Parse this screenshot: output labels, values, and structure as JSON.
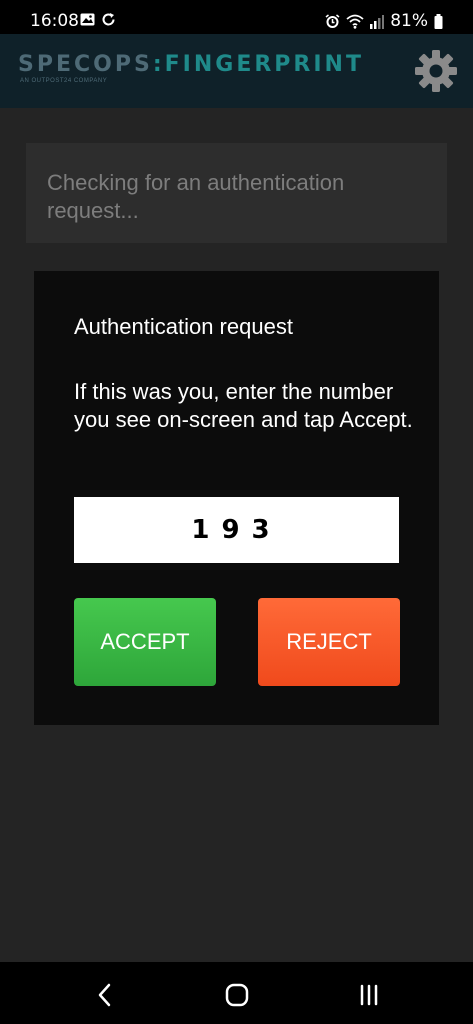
{
  "status_bar": {
    "time": "16:08",
    "battery": "81%"
  },
  "header": {
    "logo_part1": "SPECOPS",
    "logo_separator": ":",
    "logo_part2": "FINGERPRINT",
    "logo_subtitle": "AN OUTPOST24 COMPANY",
    "settings_icon": "gear-icon"
  },
  "status_card": {
    "text": "Checking for an authentication request..."
  },
  "dialog": {
    "title": "Authentication request",
    "message": "If this was you, enter the number you see on-screen and tap Accept.",
    "code_value": "193",
    "accept_label": "ACCEPT",
    "reject_label": "REJECT"
  },
  "colors": {
    "accept": "#3bb745",
    "reject": "#f55a28",
    "header_bg": "#0f2129",
    "logo_teal": "#1f8a8a"
  },
  "nav": {
    "back_icon": "back-chevron-icon",
    "home_icon": "home-icon",
    "recents_icon": "recents-icon"
  }
}
